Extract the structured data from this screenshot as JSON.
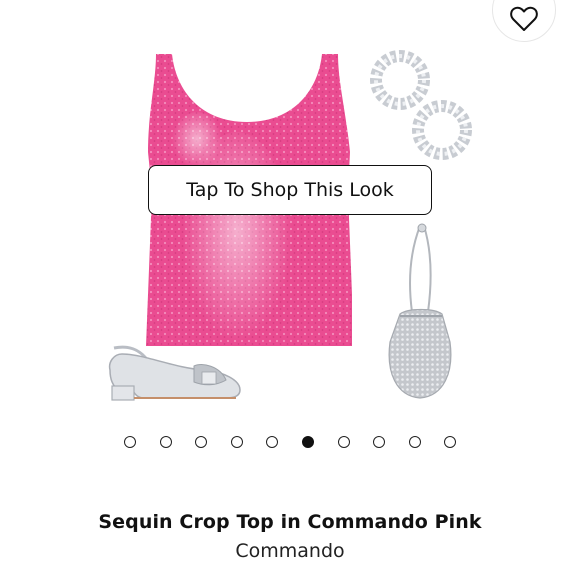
{
  "look": {
    "cta_label": "Tap To Shop This Look",
    "items": [
      "dress",
      "earrings",
      "shoe",
      "bag"
    ]
  },
  "carousel": {
    "count": 10,
    "active_index": 5
  },
  "product": {
    "title": "Sequin Crop Top in Commando Pink",
    "brand": "Commando"
  },
  "colors": {
    "dress_pink": "#ec4f93",
    "silver": "#c9cbcf",
    "text": "#111111"
  },
  "icons": {
    "wishlist": "heart-outline-icon"
  }
}
